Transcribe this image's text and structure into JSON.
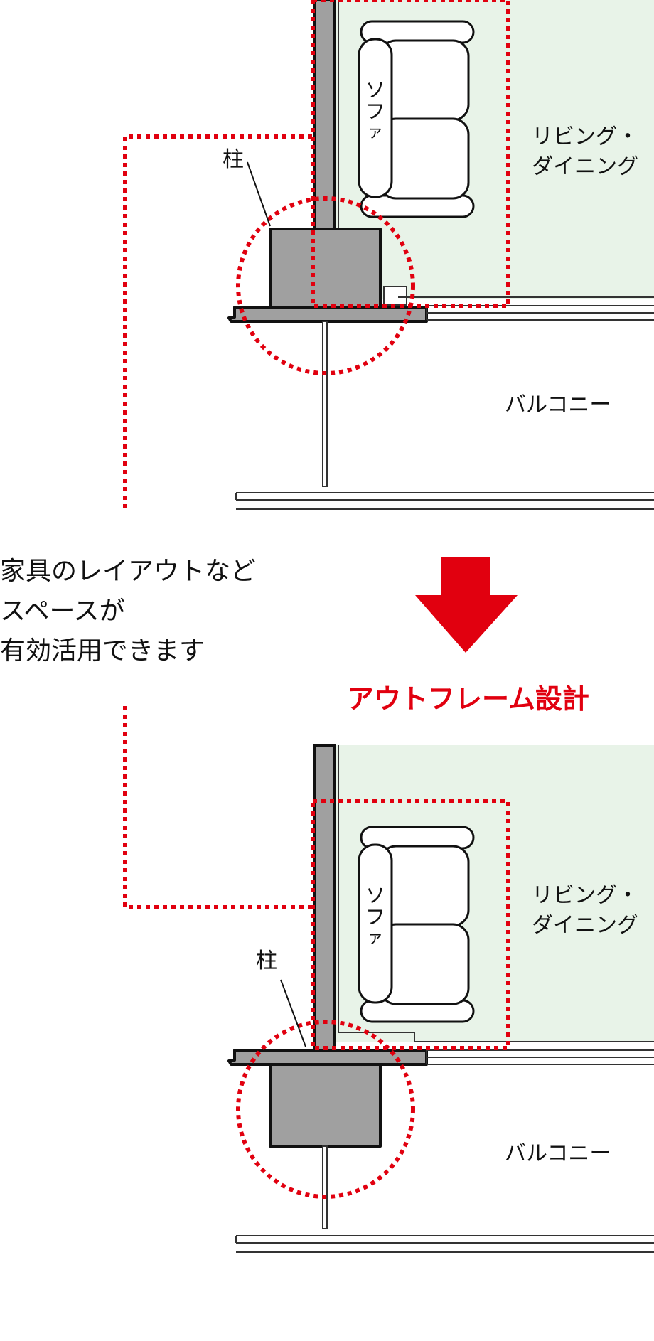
{
  "top_plan": {
    "pillar_label": "柱",
    "sofa_label_chars": [
      "ソ",
      "フ",
      "ァ"
    ],
    "living_line1": "リビング・",
    "living_line2": "ダイニング",
    "balcony_label": "バルコニー"
  },
  "middle": {
    "lines": [
      "家具のレイアウトなど",
      "スペースが",
      "有効活用できます"
    ],
    "arrow_color": "#e1000f",
    "caption": "アウトフレーム設計"
  },
  "bottom_plan": {
    "pillar_label": "柱",
    "sofa_label_chars": [
      "ソ",
      "フ",
      "ァ"
    ],
    "living_line1": "リビング・",
    "living_line2": "ダイニング",
    "balcony_label": "バルコニー"
  },
  "colors": {
    "room_fill": "#e8f3e8",
    "wall_gray": "#a0a0a0",
    "dotted_red": "#e1000f"
  }
}
